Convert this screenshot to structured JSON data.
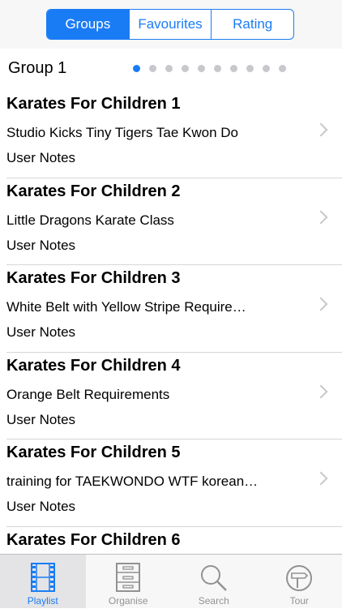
{
  "segments": [
    {
      "label": "Groups",
      "active": true
    },
    {
      "label": "Favourites",
      "active": false
    },
    {
      "label": "Rating",
      "active": false
    }
  ],
  "group": {
    "title": "Group 1",
    "page_count": 10,
    "current_page": 1
  },
  "rows": [
    {
      "title": "Karates For Children 1",
      "subtitle": "Studio Kicks  Tiny Tigers  Tae Kwon Do",
      "notes": "User Notes"
    },
    {
      "title": "Karates For Children 2",
      "subtitle": "Little Dragons Karate Class",
      "notes": "User Notes"
    },
    {
      "title": "Karates For Children 3",
      "subtitle": "White Belt with Yellow Stripe Require…",
      "notes": "User Notes"
    },
    {
      "title": "Karates For Children 4",
      "subtitle": "Orange Belt Requirements",
      "notes": "User Notes"
    },
    {
      "title": "Karates For Children 5",
      "subtitle": "training for TAEKWONDO WTF korean…",
      "notes": "User Notes"
    },
    {
      "title": "Karates For Children 6",
      "subtitle": "",
      "notes": ""
    }
  ],
  "tabs": [
    {
      "label": "Playlist",
      "icon": "film-icon",
      "active": true
    },
    {
      "label": "Organise",
      "icon": "cabinet-icon",
      "active": false
    },
    {
      "label": "Search",
      "icon": "search-icon",
      "active": false
    },
    {
      "label": "Tour",
      "icon": "signpost-icon",
      "active": false
    }
  ],
  "colors": {
    "accent": "#1a7cf5",
    "inactive": "#929292"
  }
}
